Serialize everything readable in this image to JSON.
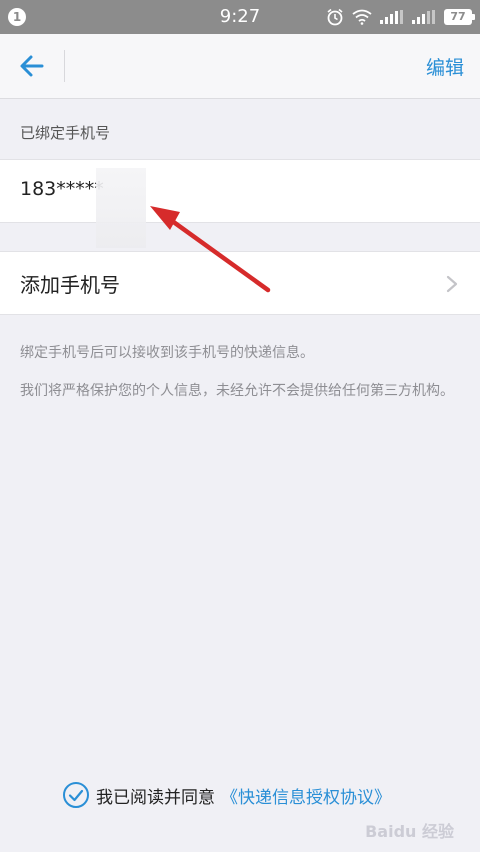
{
  "status_bar": {
    "notification_count": "1",
    "time": "9:27",
    "battery": "77",
    "icons": [
      "alarm-icon",
      "wifi-icon",
      "signal-icon",
      "signal-icon-2",
      "battery-icon"
    ]
  },
  "nav": {
    "back_icon": "back-arrow-icon",
    "edit_label": "编辑"
  },
  "bound_section": {
    "title": "已绑定手机号",
    "phone": "183*****"
  },
  "add_row": {
    "label": "添加手机号",
    "icon": "chevron-right-icon"
  },
  "info": {
    "line1": "绑定手机号后可以接收到该手机号的快递信息。",
    "line2": "我们将严格保护您的个人信息，未经允许不会提供给任何第三方机构。"
  },
  "footer": {
    "agree_text": "我已阅读并同意",
    "agree_link": "《快递信息授权协议》",
    "check_icon": "check-circle-icon"
  },
  "watermark": "Baidu 经验",
  "colors": {
    "accent": "#2a8fd6",
    "status_bar": "#8c8c8c",
    "background": "#f0f0f5",
    "annotation": "#d62b2b"
  }
}
